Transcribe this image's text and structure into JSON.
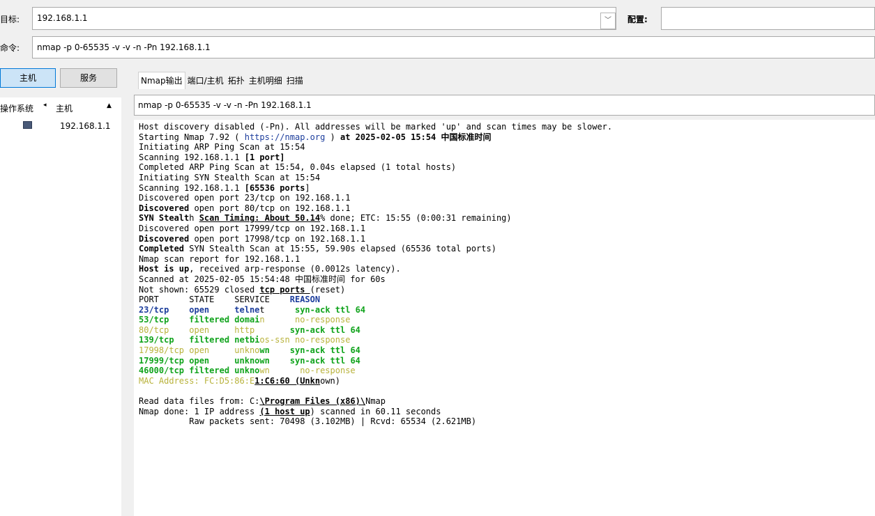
{
  "target": {
    "label": "目标:",
    "value": "192.168.1.1"
  },
  "profile": {
    "label": "配置:",
    "value": ""
  },
  "command": {
    "label": "命令:",
    "value": "nmap -p 0-65535 -v -v -n -Pn 192.168.1.1"
  },
  "view_buttons": {
    "hosts": "主机",
    "services": "服务"
  },
  "host_list": {
    "col_os": "操作系统",
    "col_host": "主机",
    "sort_icon": "▲",
    "hosts": [
      {
        "address": "192.168.1.1"
      }
    ]
  },
  "tabs": [
    "Nmap输出",
    "端口/主机",
    "拓扑",
    "主机明细",
    "扫描"
  ],
  "scan_select": {
    "value": "nmap -p 0-65535 -v -v -n -Pn 192.168.1.1"
  },
  "output": {
    "l1": "Host discovery disabled (-Pn). All addresses will be marked 'up' and scan times may be slower.",
    "l2a": "Starting Nmap 7.92 ( ",
    "l2url": "https://nmap.org",
    "l2b": " ) ",
    "l2c": "at 2025-02-05 15:54 中国标准时间",
    "l3": "Initiating ARP Ping Scan at 15:54",
    "l4a": "Scanning 192.168.1.1 ",
    "l4b": "[1 port]",
    "l5": "Completed ARP Ping Scan at 15:54, 0.04s elapsed (1 total hosts)",
    "l6": "Initiating SYN Stealth Scan at 15:54",
    "l7a": "Scanning 192.168.1.1 ",
    "l7b": "[65536 ports",
    "l7c": "]",
    "l8": "Discovered open port 23/tcp on 192.168.1.1",
    "l9a": "Discovered",
    "l9b": " open port 80/tcp on 192.168.1.1",
    "l10a": "SYN Stealt",
    "l10b": "h ",
    "l10c": "Scan Timing: About 50.14",
    "l10d": "% done; ETC: 15:55 (0:00:31 remaining)",
    "l11": "Discovered open port 17999/tcp on 192.168.1.1",
    "l12a": "Discovered",
    "l12b": " open port 17998/tcp on 192.168.1.1",
    "l13a": "Completed",
    "l13b": " SYN Stealth Scan at 15:55, 59.90s elapsed (65536 total ports)",
    "l14": "Nmap scan report for 192.168.1.1",
    "l15a": "Host is up",
    "l15b": ", received arp-response (0.0012s latency).",
    "l16": "Scanned at 2025-02-05 15:54:48 中国标准时间 for 60s",
    "l17a": "Not shown: 65529 closed ",
    "l17b": "tcp ports ",
    "l17c": "(reset)",
    "hdr_a": "PORT      STATE    SERVICE    ",
    "hdr_b": "REASON",
    "r1a": "23/tcp    open     telne",
    "r1b": "t      ",
    "r1c": "syn-ack ttl 64",
    "r2a": "53/tcp    filtered domai",
    "r2b": "n      ",
    "r2c": "no-response",
    "r3a": "80/tcp    open     http       ",
    "r3c": "syn-ack ttl 64",
    "r4a": "139/tcp   filtered netbi",
    "r4b": "os-ssn ",
    "r4c": "no-response",
    "r5a": "17998/tcp open     ",
    "r5b": "unkno",
    "r5c": "wn    ",
    "r5d": "syn-ack ttl 64",
    "r6a": "17999/tcp open     unknown    ",
    "r6c": "syn-ack ttl 64",
    "r7a": "46000/tcp filtered unkno",
    "r7b": "wn      ",
    "r7c": "no-response",
    "mac_a": "MAC Address: FC:D5:86:E",
    "mac_b": "1:C6:60 (Unkn",
    "mac_c": "own)",
    "rd_a": "Read data files from: C:",
    "rd_b": "\\Program Files (x86)\\",
    "rd_c": "Nmap",
    "done_a": "Nmap done: 1 IP address ",
    "done_b": "(1 host up",
    "done_c": ") scanned in 60.11 seconds",
    "raw": "          Raw packets sent: 70498 (3.102MB) | Rcvd: 65534 (2.621MB)"
  }
}
